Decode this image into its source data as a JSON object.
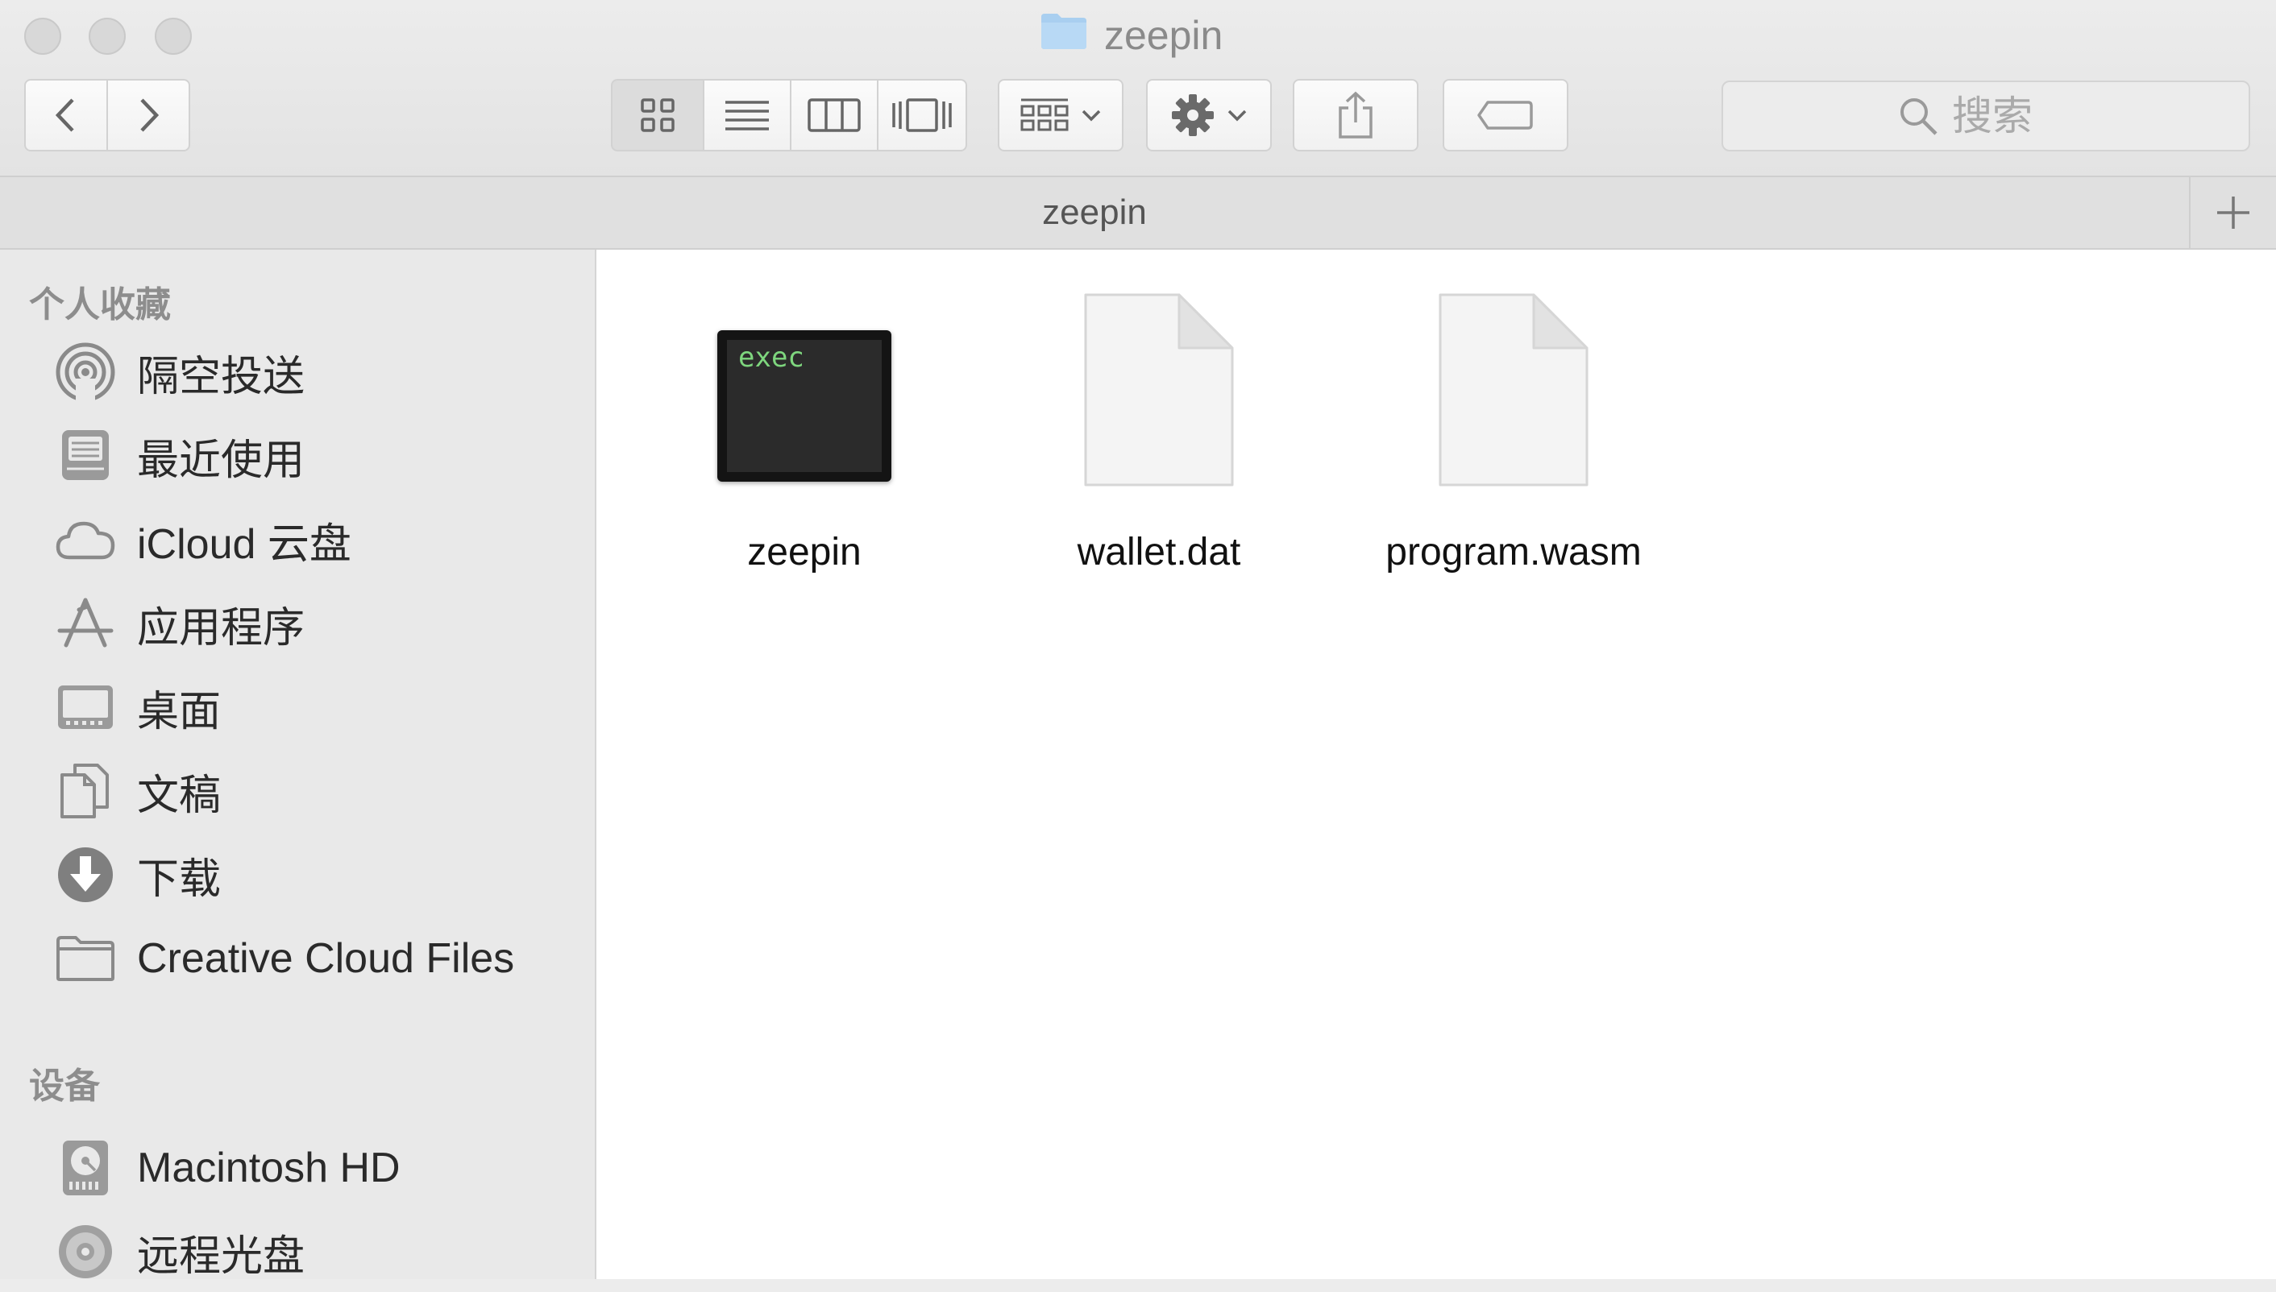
{
  "window": {
    "title": "zeepin",
    "title_icon": "folder-icon",
    "traffic_lights": [
      "close-icon",
      "minimize-icon",
      "zoom-icon"
    ]
  },
  "toolbar": {
    "nav": [
      "back-icon",
      "forward-icon"
    ],
    "view_modes": [
      "icon-view-icon",
      "list-view-icon",
      "column-view-icon",
      "cover-flow-icon"
    ],
    "active_view": "icon-view-icon",
    "group_icon": "group-by-icon",
    "action_icon": "gear-icon",
    "share_icon": "share-icon",
    "tag_icon": "tag-icon"
  },
  "search": {
    "placeholder": "搜索",
    "value": ""
  },
  "tabbar": {
    "active_tab": "zeepin",
    "add_icon": "plus-icon"
  },
  "sidebar": {
    "favorites_title": "个人收藏",
    "favorites": [
      {
        "label": "隔空投送",
        "icon": "airdrop-icon"
      },
      {
        "label": "最近使用",
        "icon": "recents-icon"
      },
      {
        "label": "iCloud 云盘",
        "icon": "icloud-icon"
      },
      {
        "label": "应用程序",
        "icon": "applications-icon"
      },
      {
        "label": "桌面",
        "icon": "desktop-icon"
      },
      {
        "label": "文稿",
        "icon": "documents-icon"
      },
      {
        "label": "下载",
        "icon": "downloads-icon"
      },
      {
        "label": "Creative Cloud Files",
        "icon": "folder-icon"
      }
    ],
    "devices_title": "设备",
    "devices": [
      {
        "label": "Macintosh HD",
        "icon": "hard-drive-icon"
      },
      {
        "label": "远程光盘",
        "icon": "remote-disc-icon"
      }
    ]
  },
  "files": [
    {
      "name": "zeepin",
      "kind": "exec",
      "badge": "exec",
      "icon": "unix-executable-icon"
    },
    {
      "name": "wallet.dat",
      "kind": "document",
      "icon": "blank-document-icon"
    },
    {
      "name": "program.wasm",
      "kind": "document",
      "icon": "blank-document-icon"
    }
  ],
  "colors": {
    "sidebar_bg": "#e9e9e9",
    "content_bg": "#ffffff",
    "folder_blue": "#a9cff0",
    "exec_text": "#7ed67e"
  }
}
